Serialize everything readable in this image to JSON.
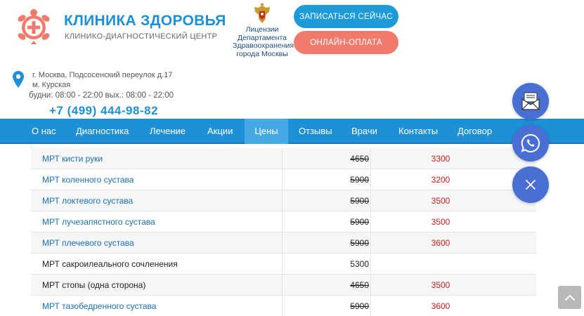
{
  "header": {
    "brand_name": "КЛИНИКА ЗДОРОВЬЯ",
    "brand_sub": "КЛИНИКО-ДИАГНОСТИЧЕСКИЙ ЦЕНТР",
    "license_lines": [
      "Лицензии",
      "Департамента",
      "Здравоохранения",
      "города Москвы"
    ],
    "signup_label": "ЗАПИСАТЬСЯ СЕЙЧАС",
    "pay_label": "ОНЛАЙН-ОПЛАТА",
    "address_line1": "г. Москва, Подсосенский переулок д.17",
    "address_line2": "м. Курская",
    "hours": "будни: 08:00 - 22:00 вых.: 08:00 - 22:00",
    "phone": "+7 (499) 444-98-82"
  },
  "nav": {
    "items": [
      "О нас",
      "Диагностика",
      "Лечение",
      "Акции",
      "Цены",
      "Отзывы",
      "Врачи",
      "Контакты",
      "Договор"
    ],
    "active": "Цены"
  },
  "prices": [
    {
      "name": "МРТ кисти руки",
      "old": "4650",
      "new": "3300",
      "link": true,
      "strike": true
    },
    {
      "name": "МРТ коленного сустава",
      "old": "5900",
      "new": "3200",
      "link": true,
      "strike": true
    },
    {
      "name": "МРТ локтевого сустава",
      "old": "5900",
      "new": "3500",
      "link": true,
      "strike": true
    },
    {
      "name": "МРТ лучезапястного сустава",
      "old": "5900",
      "new": "3500",
      "link": true,
      "strike": true
    },
    {
      "name": "МРТ плечевого сустава",
      "old": "5900",
      "new": "3600",
      "link": true,
      "strike": true
    },
    {
      "name": "МРТ сакроилеального сочленения",
      "old": "5300",
      "new": "",
      "link": false,
      "strike": false
    },
    {
      "name": "МРТ стопы (одна сторона)",
      "old": "4650",
      "new": "3500",
      "link": false,
      "strike": true
    },
    {
      "name": "МРТ тазобедренного сустава",
      "old": "5900",
      "new": "3600",
      "link": true,
      "strike": true
    }
  ],
  "colors": {
    "brand_blue": "#1f8fd6",
    "nav_blue": "#1e90d8",
    "nav_active": "#45a9e6",
    "accent_coral": "#f07b6c",
    "price_red": "#d01e1e",
    "link_blue": "#1a6fb5",
    "fab_blue": "#4a6fd4"
  },
  "icons": {
    "logo": "turtle-cross-logo",
    "emblem": "coat-of-arms-icon",
    "pin": "location-pin-icon",
    "fab_message": "envelope-icon",
    "fab_whatsapp": "whatsapp-icon",
    "fab_close": "close-icon",
    "scroll_top": "chevron-up-icon"
  }
}
